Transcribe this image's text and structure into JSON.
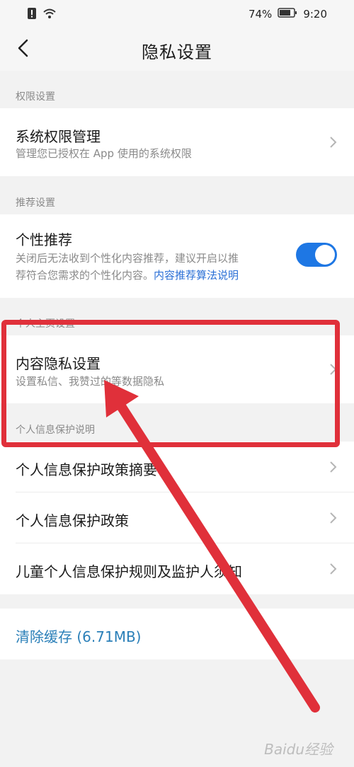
{
  "status": {
    "battery": "74%",
    "time": "9:20"
  },
  "header": {
    "title": "隐私设置"
  },
  "permissions": {
    "section_label": "权限设置",
    "item_title": "系统权限管理",
    "item_sub": "管理您已授权在 App 使用的系统权限"
  },
  "recommend": {
    "section_label": "推荐设置",
    "item_title": "个性推荐",
    "item_sub_1": "关闭后无法收到个性化内容推荐，建议开启以推",
    "item_sub_2": "荐符合您需求的个性化内容。",
    "item_link": "内容推荐算法说明",
    "toggle_on": true
  },
  "content_privacy": {
    "section_label": "个人主页设置",
    "item_title": "内容隐私设置",
    "item_sub": "设置私信、我赞过的等数据隐私"
  },
  "info_protect": {
    "section_label": "个人信息保护说明",
    "items": [
      "个人信息保护政策摘要",
      "个人信息保护政策",
      "儿童个人信息保护规则及监护人须知"
    ]
  },
  "cache": {
    "label": "清除缓存 (6.71MB)"
  },
  "watermark": {
    "text": "Baidu经验"
  },
  "colors": {
    "accent": "#1e77e4",
    "annotation": "#e0303a",
    "link": "#2a6fd6"
  }
}
